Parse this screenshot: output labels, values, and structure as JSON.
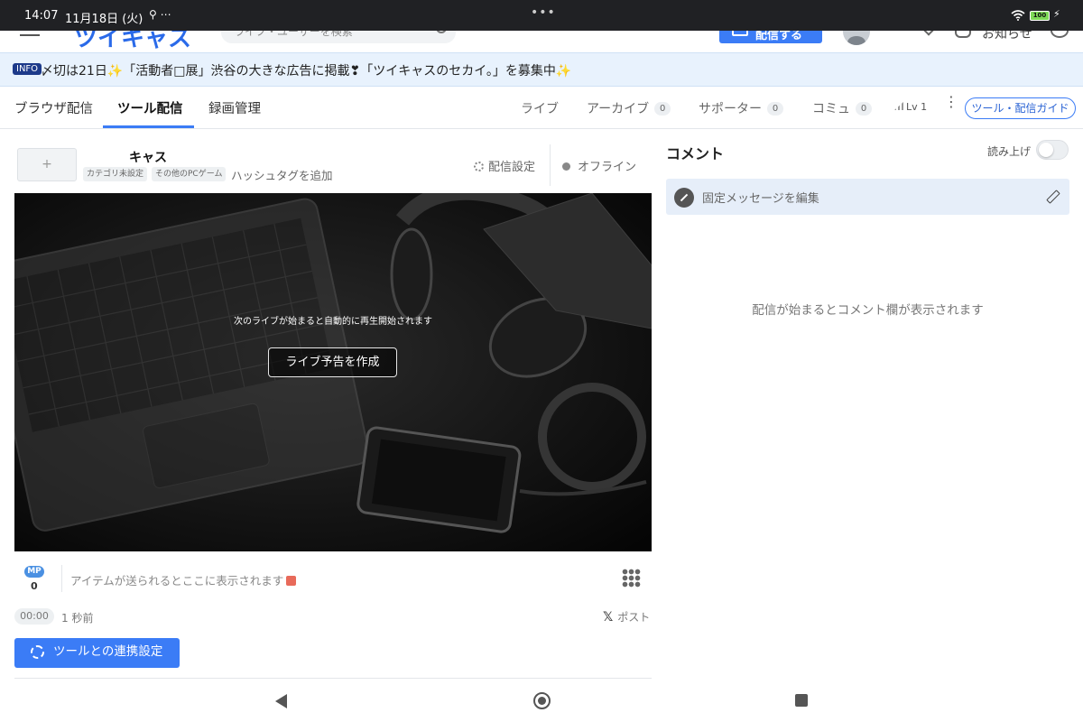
{
  "status_bar": {
    "time": "14:07",
    "date": "11月18日 (火)",
    "icons_left": "⚲ ⋯",
    "center_dots": "•••",
    "battery": "100"
  },
  "site_header": {
    "logo": "ツイキャス",
    "search_placeholder": "ライブ・ユーザーを検索",
    "live_button_label": "配信する",
    "notice_label": "お知らせ"
  },
  "banner": {
    "badge": "INFO",
    "text": "〆切は21日✨「活動者□展」渋谷の大きな広告に掲載❣「ツイキャスのセカイ。」を募集中✨"
  },
  "tabs": {
    "left": [
      {
        "label": "ブラウザ配信",
        "active": false
      },
      {
        "label": "ツール配信",
        "active": true
      },
      {
        "label": "録画管理",
        "active": false
      }
    ],
    "right": [
      {
        "label": "ライブ"
      },
      {
        "label": "アーカイブ",
        "count": "0"
      },
      {
        "label": "サポーター",
        "count": "0"
      },
      {
        "label": "コミュ",
        "count": "0"
      }
    ],
    "level": "Lv 1",
    "guide_button": "ツール・配信ガイド"
  },
  "broadcast": {
    "thumbnail_button": "+",
    "title": "キャス",
    "tags": [
      "カテゴリ未設定",
      "その他のPCゲーム"
    ],
    "hashtag_link": "ハッシュタグを追加",
    "settings_label": "配信設定",
    "status": "オフライン"
  },
  "video": {
    "message": "次のライブが始まると自動的に再生開始されます",
    "preview_button": "ライブ予告を作成"
  },
  "items": {
    "mp_badge": "MP",
    "mp_count": "0",
    "placeholder": "アイテムが送られるとここに表示されます"
  },
  "footer": {
    "timer": "00:00",
    "ago": "1 秒前",
    "post_icon": "𝕏",
    "post_label": "ポスト",
    "tool_button": "ツールとの連携設定"
  },
  "comments": {
    "title": "コメント",
    "read_aloud": "読み上げ",
    "read_aloud_enabled": false,
    "pinned_placeholder": "固定メッセージを編集",
    "empty_message": "配信が始まるとコメント欄が表示されます"
  },
  "colors": {
    "accent": "#3b7cf6",
    "banner_bg": "#e8f2fd",
    "status_bar": "#202124"
  }
}
